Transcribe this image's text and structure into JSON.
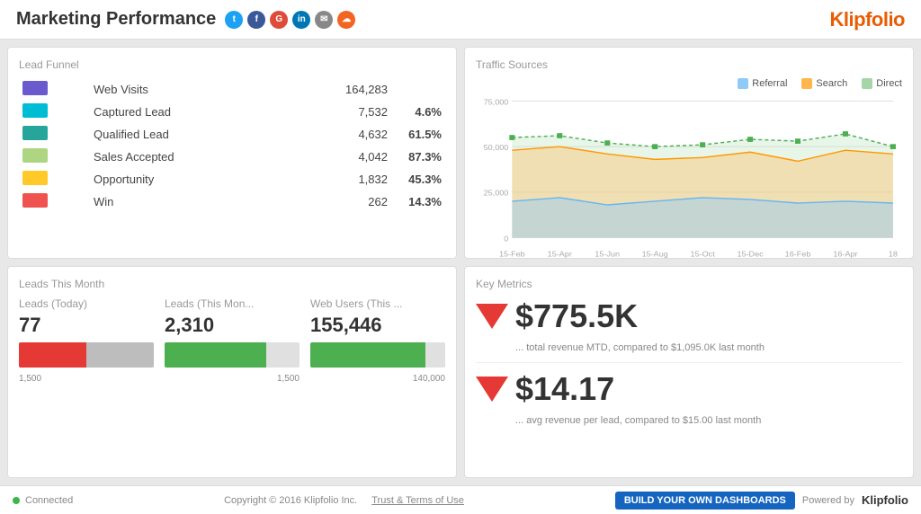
{
  "header": {
    "title": "Marketing Performance",
    "logo": "Klipfolio"
  },
  "funnel": {
    "card_title": "Lead Funnel",
    "rows": [
      {
        "color": "#6a5acd",
        "name": "Web Visits",
        "value": "164,283",
        "pct": "",
        "pct_class": ""
      },
      {
        "color": "#00bcd4",
        "name": "Captured Lead",
        "value": "7,532",
        "pct": "4.6%",
        "pct_class": "pct-green"
      },
      {
        "color": "#26a69a",
        "name": "Qualified Lead",
        "value": "4,632",
        "pct": "61.5%",
        "pct_class": "pct-red"
      },
      {
        "color": "#aed581",
        "name": "Sales Accepted",
        "value": "4,042",
        "pct": "87.3%",
        "pct_class": "pct-red"
      },
      {
        "color": "#ffca28",
        "name": "Opportunity",
        "value": "1,832",
        "pct": "45.3%",
        "pct_class": "pct-green"
      },
      {
        "color": "#ef5350",
        "name": "Win",
        "value": "262",
        "pct": "14.3%",
        "pct_class": "pct-green"
      }
    ]
  },
  "traffic": {
    "card_title": "Traffic Sources",
    "legend": [
      {
        "label": "Referral",
        "color": "#90caf9"
      },
      {
        "label": "Search",
        "color": "#ffb74d"
      },
      {
        "label": "Direct",
        "color": "#a5d6a7"
      }
    ],
    "x_labels": [
      "15-Feb",
      "15-Apr",
      "15-Jun",
      "15-Aug",
      "15-Oct",
      "15-Dec",
      "16-Feb",
      "16-Apr",
      "18"
    ],
    "y_labels": [
      "75,000",
      "50,000",
      "25,000",
      "0"
    ]
  },
  "leads": {
    "card_title": "Leads This Month",
    "metrics": [
      {
        "label": "Leads (Today)",
        "value": "77",
        "bar_pct": 50,
        "bar_color": "#e53935",
        "bar_color2": "#bdbdbd",
        "max_label": "1,500",
        "bar_type": "split"
      },
      {
        "label": "Leads (This Mon...",
        "value": "2,310",
        "bar_pct": 75,
        "bar_color": "#4caf50",
        "max_label": "1,500",
        "bar_type": "single"
      },
      {
        "label": "Web Users (This ...",
        "value": "155,446",
        "bar_pct": 85,
        "bar_color": "#4caf50",
        "max_label": "140,000",
        "bar_type": "single"
      }
    ]
  },
  "key_metrics": {
    "card_title": "Key Metrics",
    "metrics": [
      {
        "value": "$775.5K",
        "desc": "... total revenue MTD, compared to $1,095.0K last month"
      },
      {
        "value": "$14.17",
        "desc": "... avg revenue per lead, compared to $15.00 last month"
      }
    ]
  },
  "footer": {
    "connected": "Connected",
    "copyright": "Copyright © 2016 Klipfolio Inc.",
    "terms": "Trust & Terms of Use",
    "build_btn": "BUILD YOUR OWN DASHBOARDS",
    "powered_by": "Powered by",
    "logo": "Klipfolio"
  }
}
